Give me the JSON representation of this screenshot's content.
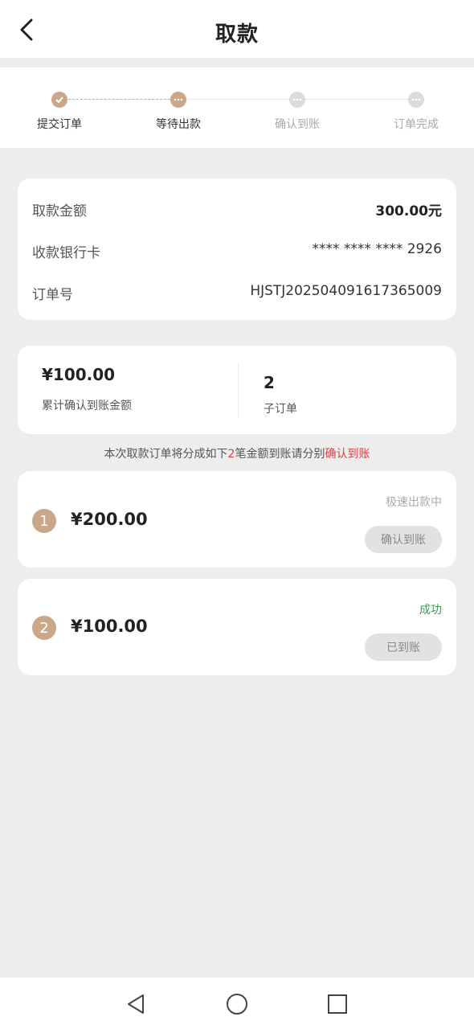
{
  "header": {
    "title": "取款"
  },
  "steps": [
    {
      "label": "提交订单",
      "state": "done"
    },
    {
      "label": "等待出款",
      "state": "current"
    },
    {
      "label": "确认到账",
      "state": "todo"
    },
    {
      "label": "订单完成",
      "state": "todo"
    }
  ],
  "info": {
    "amount_label": "取款金额",
    "amount_value": "300.00元",
    "card_label": "收款银行卡",
    "card_value": "**** **** **** 2926",
    "order_label": "订单号",
    "order_value": "HJSTJ20250409161736500​9"
  },
  "summary": {
    "confirmed_amount": "¥100.00",
    "confirmed_label": "累计确认到账金额",
    "sub_count": "2",
    "sub_label": "子订单"
  },
  "notice": {
    "prefix": "本次取款订单将分成如下",
    "count": "2",
    "middle": "笔金额到账请分别",
    "action": "确认到账"
  },
  "suborders": [
    {
      "index": "1",
      "amount": "¥200.00",
      "status": "极速出款中",
      "button": "确认到账"
    },
    {
      "index": "2",
      "amount": "¥100.00",
      "status": "成功",
      "button": "已到账"
    }
  ],
  "colors": {
    "accent": "#c9a788",
    "red": "#e03c3c",
    "success": "#3c9a5a",
    "muted": "#aaaaaa"
  }
}
